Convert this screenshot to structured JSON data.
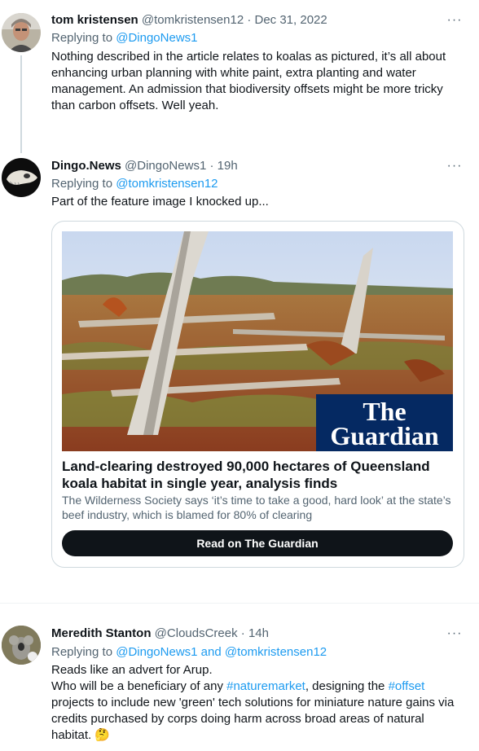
{
  "tweets": [
    {
      "name": "tom kristensen",
      "handle": "@tomkristensen12",
      "sep": "·",
      "time": "Dec 31, 2022",
      "replying_prefix": "Replying to ",
      "replying_to": "@DingoNews1",
      "text": "Nothing described in the article relates to koalas as pictured, it’s all about enhancing urban planning with white paint, extra planting and water management. An admission that biodiversity offsets might be more tricky than carbon offsets. Well yeah."
    },
    {
      "name": "Dingo.News",
      "handle": "@DingoNews1",
      "sep": "·",
      "time": "19h",
      "replying_prefix": "Replying to ",
      "replying_to": "@tomkristensen12",
      "text": "Part of the feature image I knocked up...",
      "card": {
        "logo_line1": "The",
        "logo_line2": "Guardian",
        "title": "Land-clearing destroyed 90,000 hectares of Queensland koala habitat in single year, analysis finds",
        "description": "The Wilderness Society says ‘it’s time to take a good, hard look’ at the state’s beef industry, which is blamed for 80% of clearing",
        "button": "Read on The Guardian"
      }
    },
    {
      "name": "Meredith Stanton",
      "handle": "@CloudsCreek",
      "sep": "·",
      "time": "14h",
      "replying_prefix": "Replying to ",
      "replying_to": "@DingoNews1 and @tomkristensen12",
      "text_line1": "Reads like an advert for Arup.",
      "text_line2_a": "Who will be a beneficiary of any ",
      "hashtag1": "#naturemarket",
      "text_line2_b": ", designing the ",
      "hashtag2": "#offset",
      "text_line2_c": " projects to include new 'green' tech solutions for miniature nature gains via credits purchased by corps doing harm across broad areas of natural habitat. ",
      "emoji": "🤔"
    }
  ],
  "more_icon": "···",
  "colors": {
    "link": "#1d9bf0",
    "secondary": "#536471",
    "guardian_blue": "#052962"
  }
}
